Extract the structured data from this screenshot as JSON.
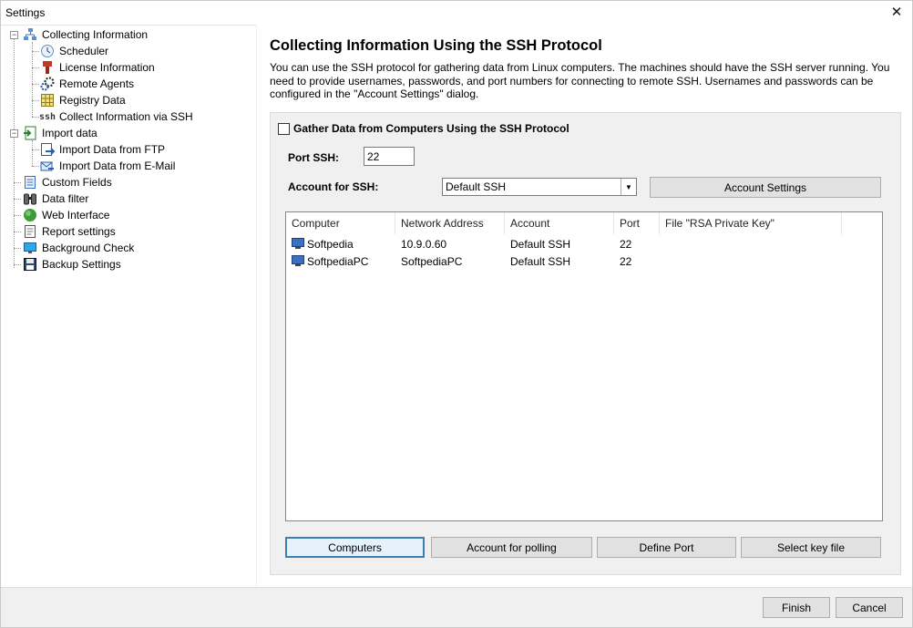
{
  "window": {
    "title": "Settings"
  },
  "tree": {
    "items": [
      {
        "label": "Collecting Information",
        "icon": "network-icon"
      },
      {
        "label": "Scheduler",
        "icon": "clock-icon"
      },
      {
        "label": "License Information",
        "icon": "license-icon"
      },
      {
        "label": "Remote Agents",
        "icon": "gears-icon"
      },
      {
        "label": "Registry Data",
        "icon": "grid-icon"
      },
      {
        "label": "Collect Information via SSH",
        "icon": "ssh-icon",
        "icon_text": "ssh"
      },
      {
        "label": "Import data",
        "icon": "import-icon"
      },
      {
        "label": "Import Data from FTP",
        "icon": "ftp-icon"
      },
      {
        "label": "Import Data from E-Mail",
        "icon": "email-import-icon"
      },
      {
        "label": "Custom Fields",
        "icon": "list-icon"
      },
      {
        "label": "Data filter",
        "icon": "binoculars-icon"
      },
      {
        "label": "Web Interface",
        "icon": "globe-icon"
      },
      {
        "label": "Report settings",
        "icon": "report-icon"
      },
      {
        "label": "Background Check",
        "icon": "monitor-icon"
      },
      {
        "label": "Backup Settings",
        "icon": "floppy-icon"
      }
    ]
  },
  "main": {
    "heading": "Collecting Information Using the SSH Protocol",
    "description": "You can use the SSH protocol for gathering data from Linux computers. The machines should have the SSH server running. You need to provide usernames, passwords, and port numbers for connecting to remote SSH. Usernames and passwords can be configured in the \"Account Settings\" dialog.",
    "gather_checkbox_label": "Gather Data from Computers Using the SSH Protocol",
    "gather_checked": false,
    "port_label": "Port SSH:",
    "port_value": "22",
    "account_label": "Account for SSH:",
    "account_selected": "Default SSH",
    "account_settings_button": "Account Settings",
    "table": {
      "columns": [
        "Computer",
        "Network Address",
        "Account",
        "Port",
        "File \"RSA Private Key\""
      ],
      "rows": [
        {
          "computer": "Softpedia",
          "address": "10.9.0.60",
          "account": "Default SSH",
          "port": "22",
          "key_file": ""
        },
        {
          "computer": "SoftpediaPC",
          "address": "SoftpediaPC",
          "account": "Default SSH",
          "port": "22",
          "key_file": ""
        }
      ]
    },
    "buttons": {
      "computers": "Computers",
      "account_polling": "Account for polling",
      "define_port": "Define Port",
      "select_key": "Select key file"
    }
  },
  "footer": {
    "finish": "Finish",
    "cancel": "Cancel"
  },
  "colors": {
    "accent": "#3c7fb1",
    "computer_icon": "#3a6fc4"
  }
}
